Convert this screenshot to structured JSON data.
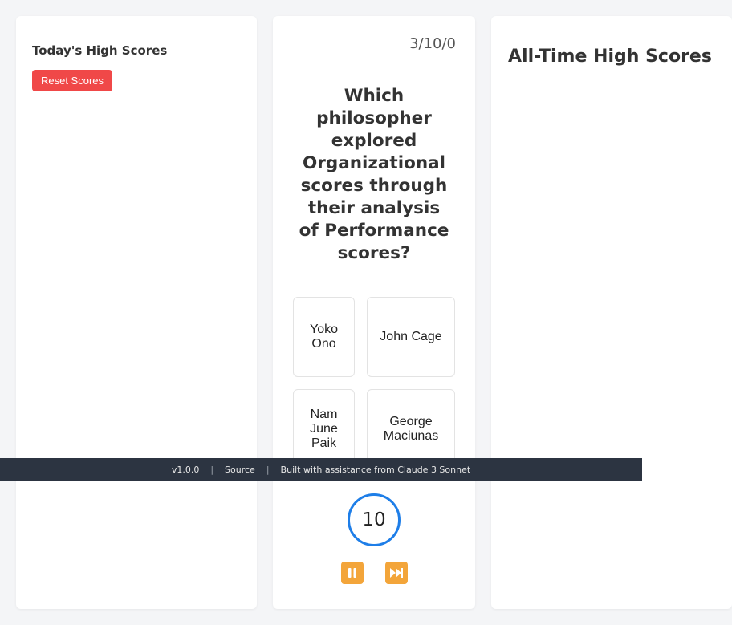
{
  "left": {
    "title": "Today's High Scores",
    "reset_label": "Reset Scores"
  },
  "quiz": {
    "score": "3/10/0",
    "question": "Which philosopher explored Organizational scores through their analysis of Performance scores?",
    "answers": [
      "Yoko Ono",
      "John Cage",
      "Nam June Paik",
      "George Maciunas"
    ],
    "timer": "10",
    "pause_icon": "pause-icon",
    "skip_icon": "fast-forward-icon"
  },
  "right": {
    "title": "All-Time High Scores"
  },
  "footer": {
    "version": "v1.0.0",
    "separator": "|",
    "source_label": "Source",
    "credit": "Built with assistance from Claude 3 Sonnet"
  },
  "colors": {
    "reset_button": "#f04848",
    "timer_ring": "#1e7ee8",
    "control_button": "#f3a53a",
    "footer_bg": "#2c3441"
  }
}
